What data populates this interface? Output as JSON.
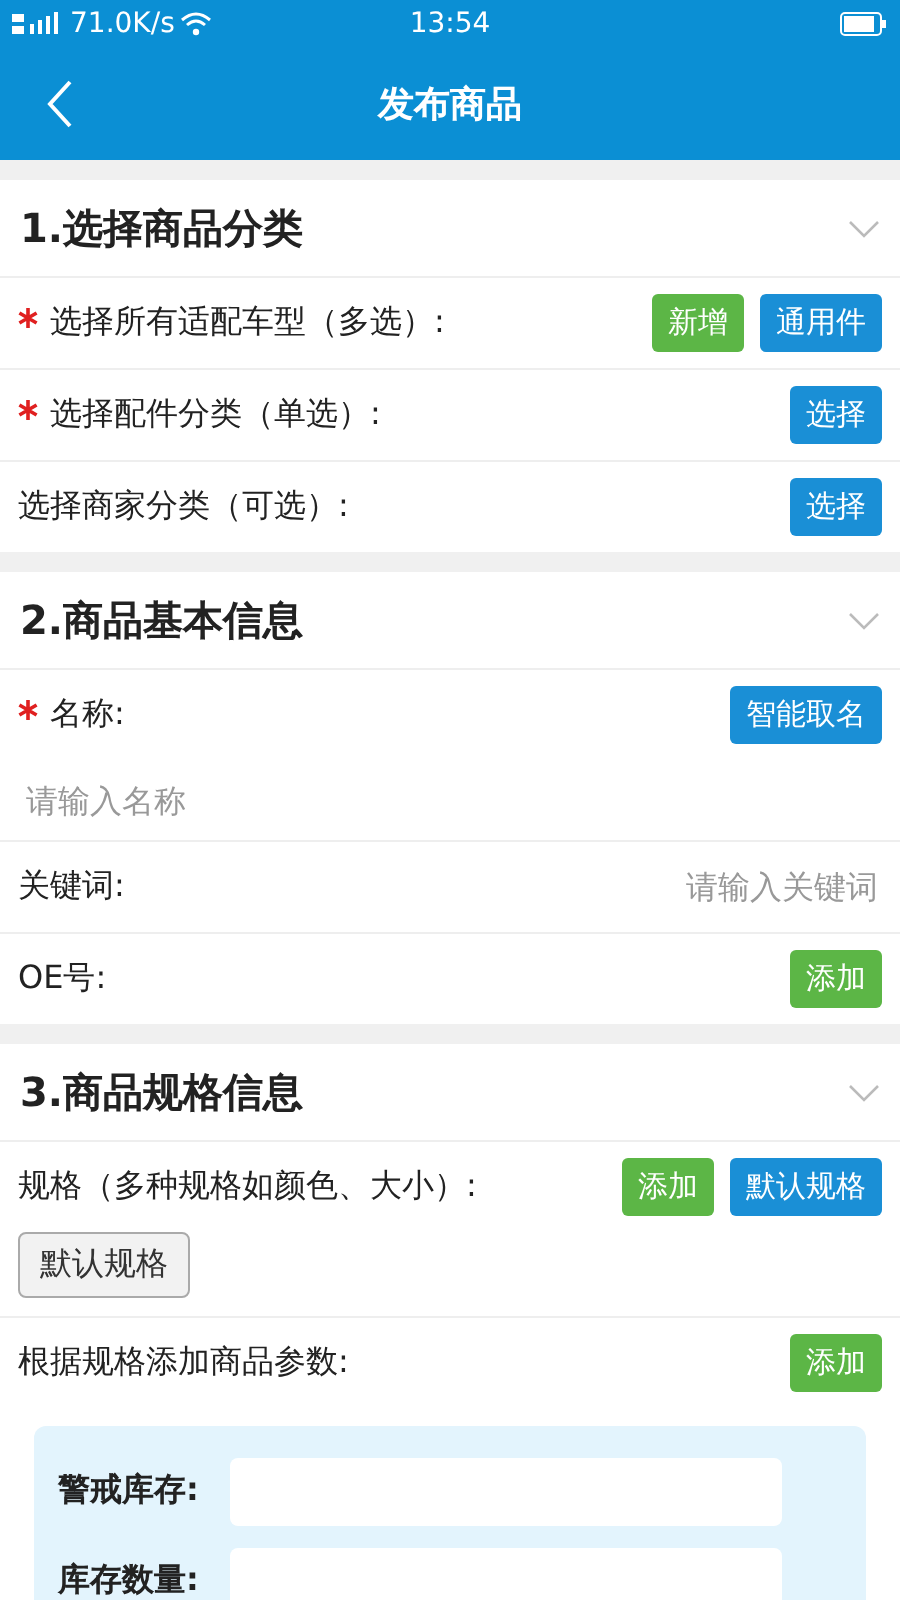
{
  "status_bar": {
    "speed": "71.0K/s",
    "time": "13:54"
  },
  "header": {
    "title": "发布商品"
  },
  "sections": [
    {
      "title": "1.选择商品分类",
      "rows": [
        {
          "kind": "buttons",
          "label": "选择所有适配车型（多选）:",
          "required": true,
          "buttons": [
            {
              "label": "新增",
              "color": "#5cb646"
            },
            {
              "label": "通用件",
              "color": "#1a8fd6"
            }
          ]
        },
        {
          "kind": "buttons",
          "label": "选择配件分类（单选）:",
          "required": true,
          "buttons": [
            {
              "label": "选择",
              "color": "#1a8fd6"
            }
          ]
        },
        {
          "kind": "buttons",
          "label": "选择商家分类（可选）:",
          "required": false,
          "buttons": [
            {
              "label": "选择",
              "color": "#1a8fd6"
            }
          ]
        }
      ]
    },
    {
      "title": "2.商品基本信息",
      "rows": [
        {
          "kind": "stacked-input",
          "label": "名称:",
          "required": true,
          "buttons": [
            {
              "label": "智能取名",
              "color": "#1a8fd6"
            }
          ],
          "placeholder": "请输入名称"
        },
        {
          "kind": "inline-input",
          "label": "关键词:",
          "required": false,
          "placeholder": "请输入关键词"
        },
        {
          "kind": "buttons",
          "label": "OE号:",
          "required": false,
          "buttons": [
            {
              "label": "添加",
              "color": "#5cb646"
            }
          ]
        }
      ]
    },
    {
      "title": "3.商品规格信息",
      "rows": [
        {
          "kind": "chips",
          "label": "规格（多种规格如颜色、大小）:",
          "required": false,
          "buttons": [
            {
              "label": "添加",
              "color": "#5cb646"
            },
            {
              "label": "默认规格",
              "color": "#1a8fd6"
            }
          ],
          "chips": [
            "默认规格"
          ]
        },
        {
          "kind": "buttons",
          "label": "根据规格添加商品参数:",
          "required": false,
          "buttons": [
            {
              "label": "添加",
              "color": "#5cb646"
            }
          ]
        }
      ]
    }
  ],
  "params": [
    {
      "label": "警戒库存:"
    },
    {
      "label": "库存数量:"
    }
  ]
}
